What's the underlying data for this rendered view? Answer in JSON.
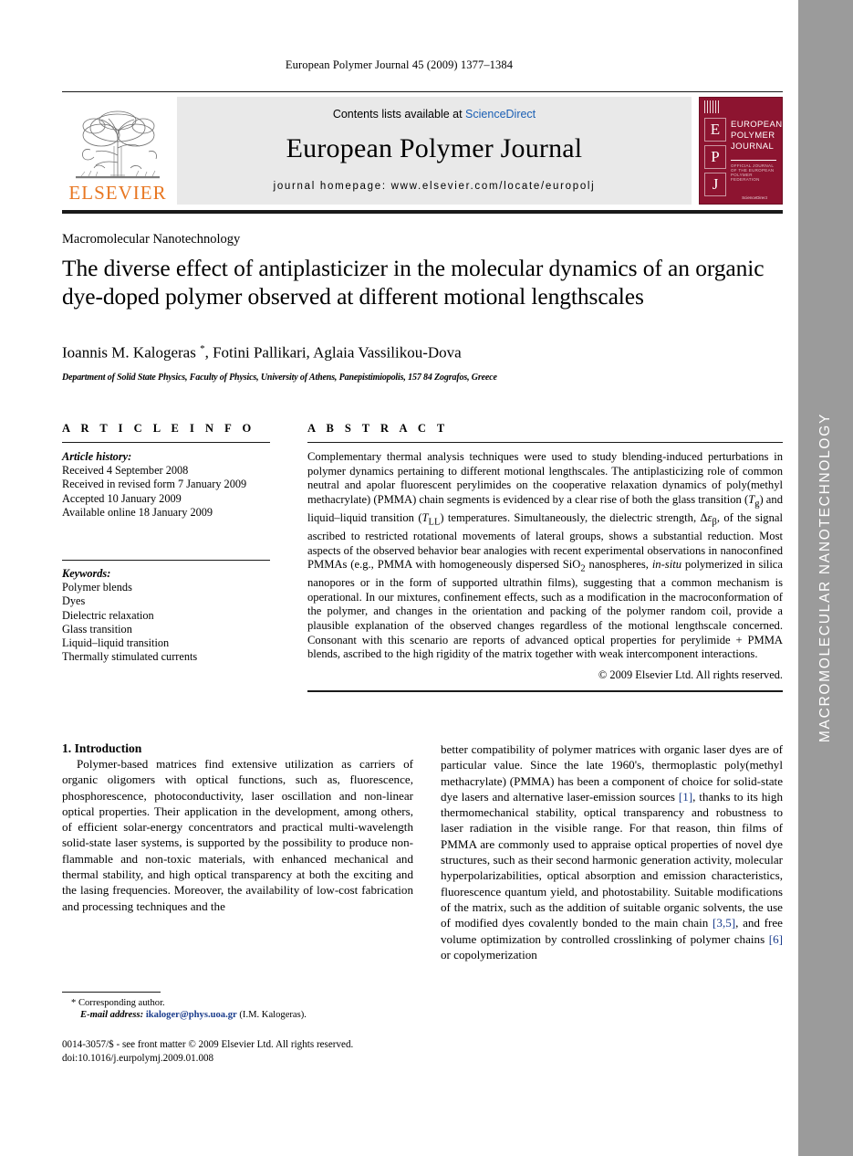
{
  "running_head": "European Polymer Journal 45 (2009) 1377–1384",
  "masthead": {
    "publisher_name": "ELSEVIER",
    "contents_prefix": "Contents lists available at ",
    "contents_link": "ScienceDirect",
    "journal_name": "European Polymer Journal",
    "homepage": "journal homepage: www.elsevier.com/locate/europolj",
    "cover": {
      "letters": [
        "E",
        "P",
        "J"
      ],
      "title_lines": [
        "EUROPEAN",
        "POLYMER",
        "JOURNAL"
      ],
      "subtitle": "OFFICIAL JOURNAL OF THE EUROPEAN POLYMER FEDERATION",
      "footer": "ScienceDirect"
    }
  },
  "side_band": {
    "label": "MACROMOLECULAR NANOTECHNOLOGY",
    "background": "#9b9b9b",
    "text_color": "#ffffff"
  },
  "article": {
    "section_label": "Macromolecular Nanotechnology",
    "title": "The diverse effect of antiplasticizer in the molecular dynamics of an organic dye-doped polymer observed at different motional lengthscales",
    "authors_html": "Ioannis M. Kalogeras <sup>*</sup>, Fotini Pallikari, Aglaia Vassilikou-Dova",
    "affiliation": "Department of Solid State Physics, Faculty of Physics, University of Athens, Panepistimiopolis, 157 84 Zografos, Greece"
  },
  "article_info": {
    "heading": "A R T I C L E  I N F O",
    "history_title": "Article history:",
    "history": [
      "Received 4 September 2008",
      "Received in revised form 7 January 2009",
      "Accepted 10 January 2009",
      "Available online 18 January 2009"
    ],
    "keywords_title": "Keywords:",
    "keywords": [
      "Polymer blends",
      "Dyes",
      "Dielectric relaxation",
      "Glass transition",
      "Liquid–liquid transition",
      "Thermally stimulated currents"
    ]
  },
  "abstract": {
    "heading": "A B S T R A C T",
    "text_html": "Complementary thermal analysis techniques were used to study blending-induced perturbations in polymer dynamics pertaining to different motional lengthscales. The antiplasticizing role of common neutral and apolar fluorescent perylimides on the cooperative relaxation dynamics of poly(methyl methacrylate) (PMMA) chain segments is evidenced by a clear rise of both the glass transition (<i>T</i><sub>g</sub>) and liquid–liquid transition (<i>T</i><sub>LL</sub>) temperatures. Simultaneously, the dielectric strength, Δ<i>ε</i><sub>β</sub>, of the signal ascribed to restricted rotational movements of lateral groups, shows a substantial reduction. Most aspects of the observed behavior bear analogies with recent experimental observations in nanoconfined PMMAs (e.g., PMMA with homogeneously dispersed SiO<sub>2</sub> nanospheres, <i>in-situ</i> polymerized in silica nanopores or in the form of supported ultrathin films), suggesting that a common mechanism is operational. In our mixtures, confinement effects, such as a modification in the macroconformation of the polymer, and changes in the orientation and packing of the polymer random coil, provide a plausible explanation of the observed changes regardless of the motional lengthscale concerned. Consonant with this scenario are reports of advanced optical properties for perylimide + PMMA blends, ascribed to the high rigidity of the matrix together with weak intercomponent interactions.",
    "copyright": "© 2009 Elsevier Ltd. All rights reserved."
  },
  "body": {
    "intro_heading": "1. Introduction",
    "left_para_html": "Polymer-based matrices find extensive utilization as carriers of organic oligomers with optical functions, such as, fluorescence, phosphorescence, photoconductivity, laser oscillation and non-linear optical properties. Their application in the development, among others, of efficient solar-energy concentrators and practical multi-wavelength solid-state laser systems, is supported by the possibility to produce non-flammable and non-toxic materials, with enhanced mechanical and thermal stability, and high optical transparency at both the exciting and the lasing frequencies. Moreover, the availability of low-cost fabrication and processing techniques and the",
    "right_para_html": "better compatibility of polymer matrices with organic laser dyes are of particular value. Since the late 1960's, thermoplastic poly(methyl methacrylate) (PMMA) has been a component of choice for solid-state dye lasers and alternative laser-emission sources <span class=\"cite\">[1]</span>, thanks to its high thermomechanical stability, optical transparency and robustness to laser radiation in the visible range. For that reason, thin films of PMMA are commonly used to appraise optical properties of novel dye structures, such as their second harmonic generation activity, molecular hyperpolarizabilities, optical absorption and emission characteristics, fluorescence quantum yield, and photostability. Suitable modifications of the matrix, such as the addition of suitable organic solvents, the use of modified dyes covalently bonded to the main chain <span class=\"cite\">[3,5]</span>, and free volume optimization by controlled crosslinking of polymer chains <span class=\"cite\">[6]</span> or copolymerization"
  },
  "footnotes": {
    "corresponding_author": "* Corresponding author.",
    "email_label": "E-mail address:",
    "email": "ikaloger@phys.uoa.gr",
    "email_suffix": "(I.M. Kalogeras).",
    "imprint_line1": "0014-3057/$ - see front matter © 2009 Elsevier Ltd. All rights reserved.",
    "imprint_line2": "doi:10.1016/j.eurpolymj.2009.01.008"
  }
}
